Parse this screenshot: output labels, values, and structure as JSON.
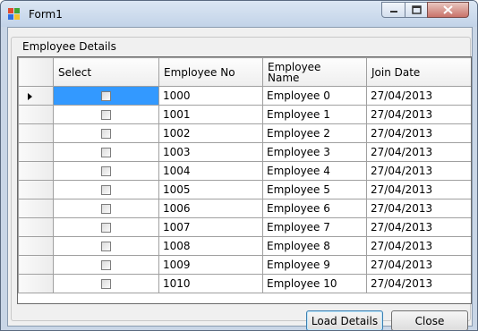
{
  "window": {
    "title": "Form1"
  },
  "group": {
    "label": "Employee Details"
  },
  "grid": {
    "headers": {
      "select": "Select",
      "emp_no": "Employee No",
      "emp_name": "Employee Name",
      "join_date": "Join Date"
    },
    "rows": [
      {
        "emp_no": "1000",
        "name": "Employee 0",
        "join": "27/04/2013",
        "checked": false
      },
      {
        "emp_no": "1001",
        "name": "Employee 1",
        "join": "27/04/2013",
        "checked": false
      },
      {
        "emp_no": "1002",
        "name": "Employee 2",
        "join": "27/04/2013",
        "checked": false
      },
      {
        "emp_no": "1003",
        "name": "Employee 3",
        "join": "27/04/2013",
        "checked": false
      },
      {
        "emp_no": "1004",
        "name": "Employee 4",
        "join": "27/04/2013",
        "checked": false
      },
      {
        "emp_no": "1005",
        "name": "Employee 5",
        "join": "27/04/2013",
        "checked": false
      },
      {
        "emp_no": "1006",
        "name": "Employee 6",
        "join": "27/04/2013",
        "checked": false
      },
      {
        "emp_no": "1007",
        "name": "Employee 7",
        "join": "27/04/2013",
        "checked": false
      },
      {
        "emp_no": "1008",
        "name": "Employee 8",
        "join": "27/04/2013",
        "checked": false
      },
      {
        "emp_no": "1009",
        "name": "Employee 9",
        "join": "27/04/2013",
        "checked": false
      },
      {
        "emp_no": "1010",
        "name": "Employee 10",
        "join": "27/04/2013",
        "checked": false
      }
    ]
  },
  "buttons": {
    "load": "Load Details",
    "close": "Close"
  },
  "icons": {
    "title_icon": "windows-form-icon",
    "minimize": "minimize-icon",
    "maximize": "maximize-icon",
    "close": "close-icon",
    "row_pointer": "row-pointer-icon"
  },
  "colors": {
    "selection": "#3399ff",
    "title_gradient_top": "#dbe6f3",
    "title_gradient_bottom": "#c2d3e8"
  }
}
